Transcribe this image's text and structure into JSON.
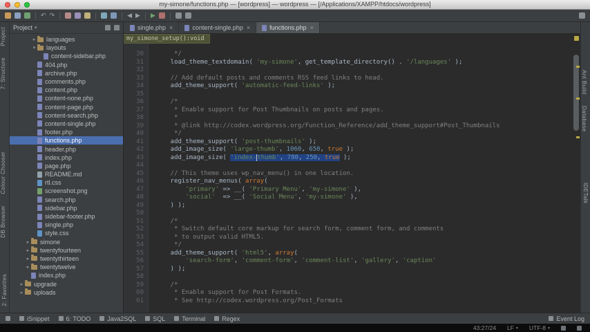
{
  "window": {
    "title": "my-simone/functions.php — [wordpress] — wordpress — [/Applications/XAMPP/htdocs/wordpress]"
  },
  "icons": {
    "close": "×",
    "dropdown": "▾",
    "arrow_right": "▸",
    "arrow_down": "▾"
  },
  "colors": {
    "editor_bg": "#2b2b2b",
    "panel_bg": "#3c3f41",
    "selection": "#214283",
    "tree_selection": "#4b6eaf",
    "string": "#6a8759",
    "number": "#6897bb",
    "keyword": "#cc7832",
    "comment": "#808080",
    "plain": "#a9b7c6",
    "light_red": "#ff5f57",
    "light_yellow": "#febc2e",
    "light_green": "#28c840"
  },
  "toolbar": {
    "icons": [
      {
        "name": "open-project-icon",
        "color": "#c79a5b"
      },
      {
        "name": "save-all-icon",
        "color": "#8aa0c0"
      },
      {
        "name": "synchronize-icon",
        "color": "#6f9f72"
      },
      {
        "name": "undo-icon",
        "glyph": "↶",
        "color": "#9aa0a6"
      },
      {
        "name": "redo-icon",
        "glyph": "↷",
        "color": "#9aa0a6"
      },
      {
        "name": "cut-icon",
        "color": "#b58a8a"
      },
      {
        "name": "copy-icon",
        "color": "#9a8fb8"
      },
      {
        "name": "paste-icon",
        "color": "#c0b07a"
      },
      {
        "name": "find-icon",
        "color": "#7fa8b8"
      },
      {
        "name": "replace-icon",
        "color": "#7f98b8"
      },
      {
        "name": "back-icon",
        "glyph": "◀",
        "color": "#9aa0a6"
      },
      {
        "name": "forward-icon",
        "glyph": "▶",
        "color": "#9aa0a6"
      },
      {
        "name": "run-icon",
        "glyph": "▶",
        "color": "#6fa46f"
      },
      {
        "name": "debug-icon",
        "color": "#b0706e"
      },
      {
        "name": "settings-icon",
        "color": "#8a8f94"
      },
      {
        "name": "help-icon",
        "color": "#8a8f94"
      }
    ]
  },
  "tool_stripes": {
    "left_top": [
      "Project",
      "7: Structure"
    ],
    "left_middle": [
      "Colour Chooser",
      "DB Browser"
    ],
    "left_bottom": [
      "2: Favorites"
    ],
    "right_top": [
      "Ant Build",
      "Database"
    ],
    "right_bottom": [
      "IDETalk"
    ]
  },
  "project": {
    "title": "Project",
    "tree": [
      {
        "label": "languages",
        "icon": "folder",
        "indent": 3,
        "arrow": "right"
      },
      {
        "label": "layouts",
        "icon": "folder",
        "indent": 3,
        "arrow": "down"
      },
      {
        "label": "content-sidebar.php",
        "icon": "php",
        "indent": 4
      },
      {
        "label": "404.php",
        "icon": "php",
        "indent": 3
      },
      {
        "label": "archive.php",
        "icon": "php",
        "indent": 3
      },
      {
        "label": "comments.php",
        "icon": "php",
        "indent": 3
      },
      {
        "label": "content.php",
        "icon": "php",
        "indent": 3
      },
      {
        "label": "content-none.php",
        "icon": "php",
        "indent": 3
      },
      {
        "label": "content-page.php",
        "icon": "php",
        "indent": 3
      },
      {
        "label": "content-search.php",
        "icon": "php",
        "indent": 3
      },
      {
        "label": "content-single.php",
        "icon": "php",
        "indent": 3
      },
      {
        "label": "footer.php",
        "icon": "php",
        "indent": 3
      },
      {
        "label": "functions.php",
        "icon": "php",
        "indent": 3,
        "selected": true
      },
      {
        "label": "header.php",
        "icon": "php",
        "indent": 3
      },
      {
        "label": "index.php",
        "icon": "php",
        "indent": 3
      },
      {
        "label": "page.php",
        "icon": "php",
        "indent": 3
      },
      {
        "label": "README.md",
        "icon": "md",
        "indent": 3
      },
      {
        "label": "rtl.css",
        "icon": "css",
        "indent": 3
      },
      {
        "label": "screenshot.png",
        "icon": "img",
        "indent": 3
      },
      {
        "label": "search.php",
        "icon": "php",
        "indent": 3
      },
      {
        "label": "sidebar.php",
        "icon": "php",
        "indent": 3
      },
      {
        "label": "sidebar-footer.php",
        "icon": "php",
        "indent": 3
      },
      {
        "label": "single.php",
        "icon": "php",
        "indent": 3
      },
      {
        "label": "style.css",
        "icon": "css",
        "indent": 3
      },
      {
        "label": "simone",
        "icon": "folder",
        "indent": 2,
        "arrow": "right"
      },
      {
        "label": "twentyfourteen",
        "icon": "folder",
        "indent": 2,
        "arrow": "right"
      },
      {
        "label": "twentythirteen",
        "icon": "folder",
        "indent": 2,
        "arrow": "right"
      },
      {
        "label": "twentytwelve",
        "icon": "folder",
        "indent": 2,
        "arrow": "right"
      },
      {
        "label": "index.php",
        "icon": "php",
        "indent": 2
      },
      {
        "label": "upgrade",
        "icon": "folder",
        "indent": 1,
        "arrow": "right"
      },
      {
        "label": "uploads",
        "icon": "folder",
        "indent": 1,
        "arrow": "right"
      }
    ]
  },
  "tabs": [
    {
      "label": "single.php",
      "icon": "php"
    },
    {
      "label": "content-single.php",
      "icon": "php"
    },
    {
      "label": "functions.php",
      "icon": "php",
      "active": true
    }
  ],
  "context_info": {
    "text": "my_simone_setup():void"
  },
  "editor": {
    "lines": [
      {
        "n": 30,
        "seg": [
          [
            "cm",
            "     */"
          ]
        ]
      },
      {
        "n": 31,
        "seg": [
          [
            "pl",
            "    load_theme_textdomain( "
          ],
          [
            "st",
            "'my-simone'"
          ],
          [
            "pl",
            ", get_template_directory() . "
          ],
          [
            "st",
            "'/languages'"
          ],
          [
            "pl",
            " );"
          ]
        ]
      },
      {
        "n": 32,
        "seg": []
      },
      {
        "n": 33,
        "seg": [
          [
            "cm",
            "    // Add default posts and comments RSS feed links to head."
          ]
        ]
      },
      {
        "n": 34,
        "seg": [
          [
            "pl",
            "    add_theme_support( "
          ],
          [
            "st",
            "'automatic-feed-links'"
          ],
          [
            "pl",
            " );"
          ]
        ]
      },
      {
        "n": 35,
        "seg": []
      },
      {
        "n": 36,
        "seg": [
          [
            "cm",
            "    /*"
          ]
        ]
      },
      {
        "n": 37,
        "seg": [
          [
            "cm",
            "     * Enable support for Post Thumbnails on posts and pages."
          ]
        ]
      },
      {
        "n": 38,
        "seg": [
          [
            "cm",
            "     *"
          ]
        ]
      },
      {
        "n": 39,
        "seg": [
          [
            "cm",
            "     * @link http://codex.wordpress.org/Function_Reference/add_theme_support#Post_Thumbnails"
          ]
        ]
      },
      {
        "n": 40,
        "seg": [
          [
            "cm",
            "     */"
          ]
        ]
      },
      {
        "n": 41,
        "seg": [
          [
            "pl",
            "    add_theme_support( "
          ],
          [
            "st",
            "'post-thumbnails'"
          ],
          [
            "pl",
            " );"
          ]
        ]
      },
      {
        "n": 42,
        "seg": [
          [
            "pl",
            "    add_image_size( "
          ],
          [
            "st",
            "'large-thumb'"
          ],
          [
            "pl",
            ", "
          ],
          [
            "nu",
            "1060"
          ],
          [
            "pl",
            ", "
          ],
          [
            "nu",
            "650"
          ],
          [
            "pl",
            ", "
          ],
          [
            "kw",
            "true"
          ],
          [
            "pl",
            " );"
          ]
        ]
      },
      {
        "n": 43,
        "seg": [
          [
            "pl",
            "    add_image_size( "
          ],
          [
            "st",
            "'index-",
            1
          ],
          [
            "caret",
            ""
          ],
          [
            "st",
            "thumb'",
            1
          ],
          [
            "pl",
            ", ",
            1
          ],
          [
            "nu",
            "780",
            1
          ],
          [
            "pl",
            ", ",
            1
          ],
          [
            "nu",
            "250",
            1
          ],
          [
            "pl",
            ", ",
            1
          ],
          [
            "kw",
            "true",
            1
          ],
          [
            "pl",
            " );"
          ]
        ]
      },
      {
        "n": 44,
        "seg": []
      },
      {
        "n": 45,
        "seg": [
          [
            "cm",
            "    // This theme uses wp_nav_menu() in one location."
          ]
        ]
      },
      {
        "n": 46,
        "seg": [
          [
            "pl",
            "    register_nav_menus( "
          ],
          [
            "kw",
            "array"
          ],
          [
            "pl",
            "("
          ]
        ]
      },
      {
        "n": 47,
        "seg": [
          [
            "pl",
            "        "
          ],
          [
            "st",
            "'primary'"
          ],
          [
            "pl",
            " => __( "
          ],
          [
            "st",
            "'Primary Menu'"
          ],
          [
            "pl",
            ", "
          ],
          [
            "st",
            "'my-simone'"
          ],
          [
            "pl",
            " ),"
          ]
        ]
      },
      {
        "n": 48,
        "seg": [
          [
            "pl",
            "        "
          ],
          [
            "st",
            "'social'"
          ],
          [
            "pl",
            "  => __( "
          ],
          [
            "st",
            "'Social Menu'"
          ],
          [
            "pl",
            ", "
          ],
          [
            "st",
            "'my-simone'"
          ],
          [
            "pl",
            " ),"
          ]
        ]
      },
      {
        "n": 49,
        "seg": [
          [
            "pl",
            "    ) );"
          ]
        ]
      },
      {
        "n": 50,
        "seg": []
      },
      {
        "n": 51,
        "seg": [
          [
            "cm",
            "    /*"
          ]
        ]
      },
      {
        "n": 52,
        "seg": [
          [
            "cm",
            "     * Switch default core markup for search form, comment form, and comments"
          ]
        ]
      },
      {
        "n": 53,
        "seg": [
          [
            "cm",
            "     * to output valid HTML5."
          ]
        ]
      },
      {
        "n": 54,
        "seg": [
          [
            "cm",
            "     */"
          ]
        ]
      },
      {
        "n": 55,
        "seg": [
          [
            "pl",
            "    add_theme_support( "
          ],
          [
            "st",
            "'html5'"
          ],
          [
            "pl",
            ", "
          ],
          [
            "kw",
            "array"
          ],
          [
            "pl",
            "("
          ]
        ]
      },
      {
        "n": 56,
        "seg": [
          [
            "pl",
            "        "
          ],
          [
            "st",
            "'search-form'"
          ],
          [
            "pl",
            ", "
          ],
          [
            "st",
            "'comment-form'"
          ],
          [
            "pl",
            ", "
          ],
          [
            "st",
            "'comment-list'"
          ],
          [
            "pl",
            ", "
          ],
          [
            "st",
            "'gallery'"
          ],
          [
            "pl",
            ", "
          ],
          [
            "st",
            "'caption'"
          ]
        ]
      },
      {
        "n": 57,
        "seg": [
          [
            "pl",
            "    ) );"
          ]
        ]
      },
      {
        "n": 58,
        "seg": []
      },
      {
        "n": 59,
        "seg": [
          [
            "cm",
            "    /*"
          ]
        ]
      },
      {
        "n": 60,
        "seg": [
          [
            "cm",
            "     * Enable support for Post Formats."
          ]
        ]
      },
      {
        "n": 61,
        "seg": [
          [
            "cm",
            "     * See http://codex.wordpress.org/Post_Formats"
          ]
        ]
      }
    ]
  },
  "statusbar": {
    "left": [
      "iSnippet",
      "6: TODO",
      "Java2SQL",
      "SQL",
      "Terminal",
      "Regex"
    ],
    "right": [
      "Event Log"
    ]
  },
  "bottom_band": {
    "position": "43:27/24",
    "line_sep": "LF",
    "encoding": "UTF-8"
  }
}
